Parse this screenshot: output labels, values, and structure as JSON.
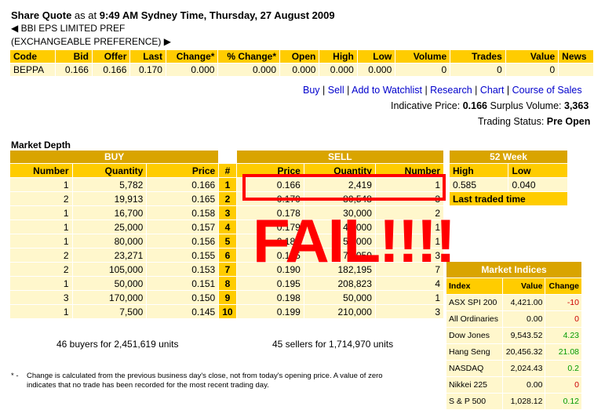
{
  "quote": {
    "title_prefix": "Share Quote",
    "title_mid": "as at",
    "title_time": "9:49 AM Sydney Time, Thursday, 27 August 2009",
    "company": "BBI EPS LIMITED PREF",
    "security": "(EXCHANGEABLE PREFERENCE)"
  },
  "quote_table": {
    "headers": [
      "Code",
      "Bid",
      "Offer",
      "Last",
      "Change*",
      "% Change*",
      "Open",
      "High",
      "Low",
      "Volume",
      "Trades",
      "Value",
      "News"
    ],
    "row": [
      "BEPPA",
      "0.166",
      "0.166",
      "0.170",
      "0.000",
      "0.000",
      "0.000",
      "0.000",
      "0.000",
      "0",
      "0",
      "0",
      ""
    ]
  },
  "links": [
    "Buy",
    "Sell",
    "Add to Watchlist",
    "Research",
    "Chart",
    "Course of Sales"
  ],
  "indicative": {
    "label": "Indicative Price:",
    "price": "0.166",
    "surplus_label": "Surplus Volume:",
    "surplus": "3,363"
  },
  "trading_status": {
    "label": "Trading Status:",
    "value": "Pre Open"
  },
  "market_depth": {
    "title": "Market Depth",
    "buy_label": "BUY",
    "sell_label": "SELL",
    "headers": [
      "Number",
      "Quantity",
      "Price",
      "#",
      "Price",
      "Quantity",
      "Number"
    ],
    "rows": [
      [
        "1",
        "5,782",
        "0.166",
        "1",
        "0.166",
        "2,419",
        "1"
      ],
      [
        "2",
        "19,913",
        "0.165",
        "2",
        "0.170",
        "80,548",
        "3"
      ],
      [
        "1",
        "16,700",
        "0.158",
        "3",
        "0.178",
        "30,000",
        "2"
      ],
      [
        "1",
        "25,000",
        "0.157",
        "4",
        "0.179",
        "45,000",
        "1"
      ],
      [
        "1",
        "80,000",
        "0.156",
        "5",
        "0.180",
        "50,000",
        "1"
      ],
      [
        "2",
        "23,271",
        "0.155",
        "6",
        "0.185",
        "79,050",
        "3"
      ],
      [
        "2",
        "105,000",
        "0.153",
        "7",
        "0.190",
        "182,195",
        "7"
      ],
      [
        "1",
        "50,000",
        "0.151",
        "8",
        "0.195",
        "208,823",
        "4"
      ],
      [
        "3",
        "170,000",
        "0.150",
        "9",
        "0.198",
        "50,000",
        "1"
      ],
      [
        "1",
        "7,500",
        "0.145",
        "10",
        "0.199",
        "210,000",
        "3"
      ]
    ],
    "buyers_summary": "46 buyers for 2,451,619 units",
    "sellers_summary": "45 sellers for 1,714,970 units"
  },
  "week52": {
    "title": "52 Week",
    "high_label": "High",
    "low_label": "Low",
    "high": "0.585",
    "low": "0.040",
    "last_traded": "Last traded time"
  },
  "indices": {
    "title": "Market Indices",
    "headers": [
      "Index",
      "Value",
      "Change"
    ],
    "rows": [
      {
        "name": "ASX SPI 200",
        "value": "4,421.00",
        "change": "-10",
        "dir": "neg"
      },
      {
        "name": "All Ordinaries",
        "value": "0.00",
        "change": "0",
        "dir": "neg"
      },
      {
        "name": "Dow Jones",
        "value": "9,543.52",
        "change": "4.23",
        "dir": "pos"
      },
      {
        "name": "Hang Seng",
        "value": "20,456.32",
        "change": "21.08",
        "dir": "pos"
      },
      {
        "name": "NASDAQ",
        "value": "2,024.43",
        "change": "0.2",
        "dir": "pos"
      },
      {
        "name": "Nikkei 225",
        "value": "0.00",
        "change": "0",
        "dir": "neg"
      },
      {
        "name": "S & P 500",
        "value": "1,028.12",
        "change": "0.12",
        "dir": "pos"
      }
    ]
  },
  "footnote": {
    "mark": "* -",
    "line1": "Change is calculated from the previous business day's close, not from today's opening price. A value of zero",
    "line2": "indicates that no trade has been recorded for the most recent trading day."
  },
  "overlay": {
    "text": "FAIL!!!!",
    "color": "#ff0000"
  }
}
